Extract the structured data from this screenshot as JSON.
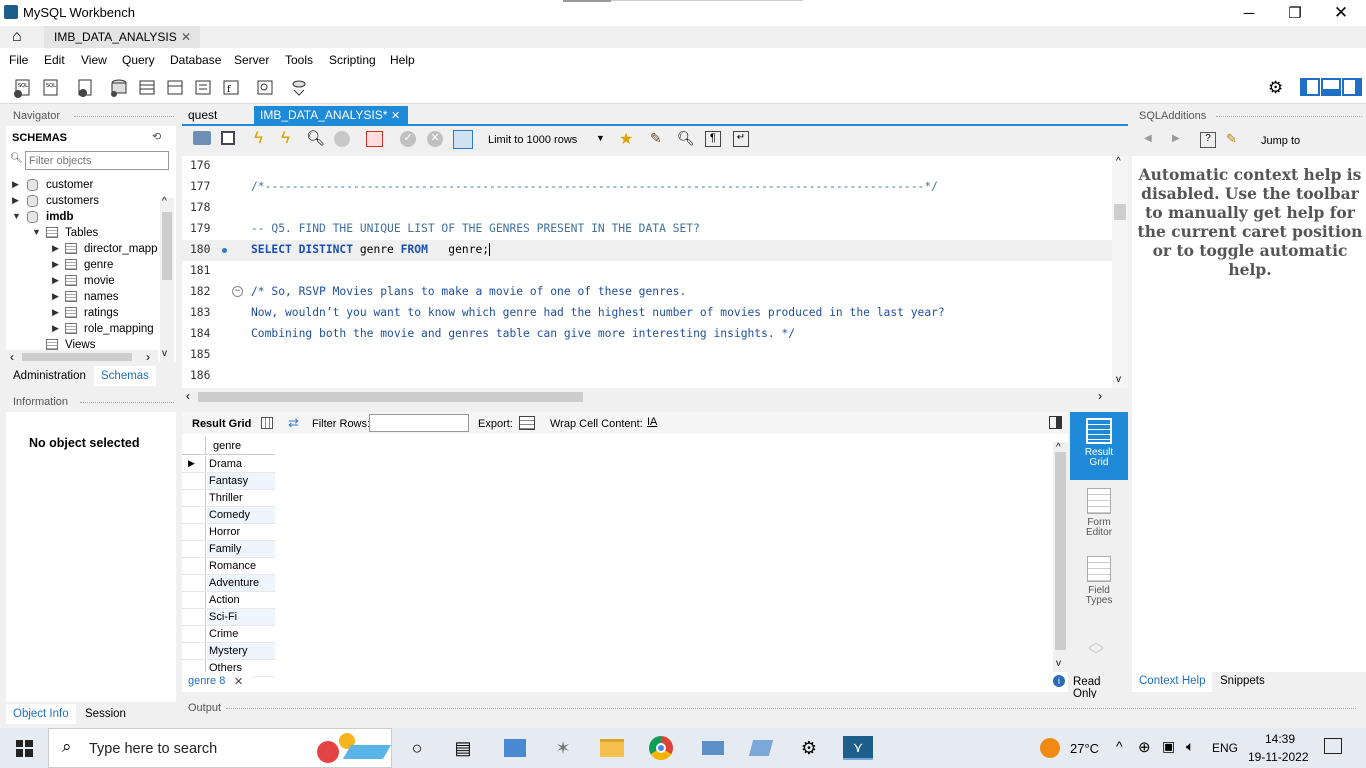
{
  "window": {
    "title": "MySQL Workbench"
  },
  "conn_tab": {
    "label": "IMB_DATA_ANALYSIS"
  },
  "menu": [
    "File",
    "Edit",
    "View",
    "Query",
    "Database",
    "Server",
    "Tools",
    "Scripting",
    "Help"
  ],
  "navigator": {
    "header": "Navigator",
    "schemas_label": "SCHEMAS",
    "filter_placeholder": "Filter objects",
    "schemas": [
      "customer",
      "customers",
      "imdb"
    ],
    "tables_label": "Tables",
    "tables": [
      "director_mapp",
      "genre",
      "movie",
      "names",
      "ratings",
      "role_mapping"
    ],
    "views_label": "Views",
    "tabs": [
      "Administration",
      "Schemas"
    ],
    "info_header": "Information",
    "no_object": "No object selected",
    "bottom_tabs": [
      "Object Info",
      "Session"
    ]
  },
  "editor": {
    "tabs": [
      "quest",
      "IMB_DATA_ANALYSIS*"
    ],
    "limit_label": "Limit to 1000 rows",
    "lines": [
      {
        "n": "176",
        "t": ""
      },
      {
        "n": "177",
        "t": "/*-------------------------------------------------------------------------------------------------*/"
      },
      {
        "n": "178",
        "t": ""
      },
      {
        "n": "179",
        "t": "-- Q5. FIND THE UNIQUE LIST OF THE GENRES PRESENT IN THE DATA SET?"
      },
      {
        "n": "180",
        "t": "SELECT DISTINCT genre FROM   genre;"
      },
      {
        "n": "181",
        "t": ""
      },
      {
        "n": "182",
        "t": "/* So, RSVP Movies plans to make a movie of one of these genres."
      },
      {
        "n": "183",
        "t": "Now, wouldn’t you want to know which genre had the highest number of movies produced in the last year?"
      },
      {
        "n": "184",
        "t": "Combining both the movie and genres table can give more interesting insights. */"
      },
      {
        "n": "185",
        "t": ""
      },
      {
        "n": "186",
        "t": ""
      }
    ],
    "kw_select": "SELECT DISTINCT",
    "kw_genre": "genre",
    "kw_from": "FROM",
    "kw_tail": "genre;"
  },
  "result": {
    "result_grid_label": "Result Grid",
    "filter_rows_label": "Filter Rows:",
    "export_label": "Export:",
    "wrap_label": "Wrap Cell Content:",
    "column": "genre",
    "rows": [
      "Drama",
      "Fantasy",
      "Thriller",
      "Comedy",
      "Horror",
      "Family",
      "Romance",
      "Adventure",
      "Action",
      "Sci-Fi",
      "Crime",
      "Mystery",
      "Others"
    ],
    "result_tab": "genre 8",
    "read_only": "Read Only",
    "side_buttons": [
      "Result Grid",
      "Form Editor",
      "Field Types"
    ]
  },
  "output": {
    "label": "Output"
  },
  "sql_additions": {
    "header": "SQLAdditions",
    "jump_to": "Jump to",
    "help_text": "Automatic context help is disabled. Use the toolbar to manually get help for the current caret position or to toggle automatic help.",
    "tabs": [
      "Context Help",
      "Snippets"
    ]
  },
  "taskbar": {
    "search_placeholder": "Type here to search",
    "weather": "27°C",
    "lang": "ENG",
    "time": "14:39",
    "date": "19-11-2022"
  }
}
